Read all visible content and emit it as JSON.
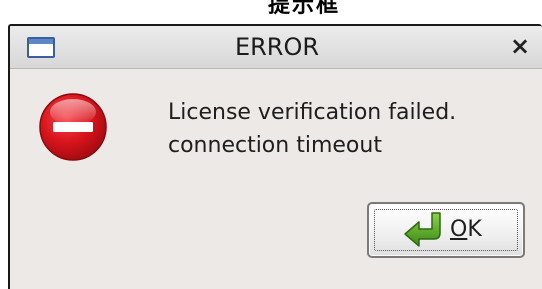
{
  "background_text": "提示框",
  "window": {
    "title": "ERROR",
    "close_glyph": "×",
    "icons": {
      "window": "window-icon",
      "close": "close-icon",
      "error": "error-icon",
      "ok": "green-arrow-icon"
    }
  },
  "message": {
    "line1": "License verification failed.",
    "line2": "connection timeout"
  },
  "buttons": {
    "ok_mnemonic": "O",
    "ok_rest": "K"
  },
  "colors": {
    "error_red": "#d8141c",
    "ok_arrow_green": "#5fa52a"
  }
}
